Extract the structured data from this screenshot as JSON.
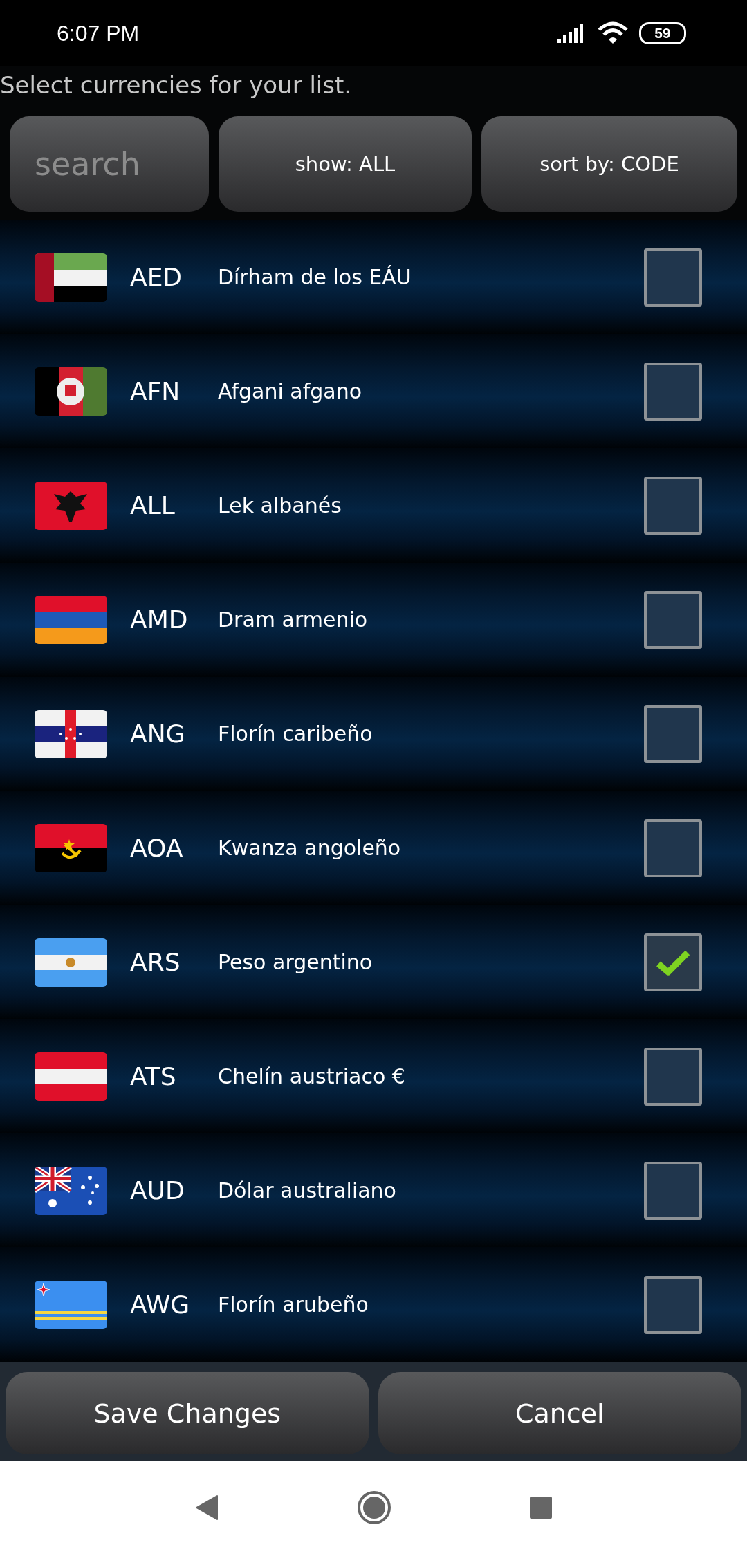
{
  "status_bar": {
    "time": "6:07 PM",
    "battery": "59"
  },
  "prompt": "Select currencies for your list.",
  "search": {
    "placeholder": "search"
  },
  "filter_button": "show: ALL",
  "sort_button": "sort by: CODE",
  "currencies": [
    {
      "code": "AED",
      "name": "Dírham de los EÁU",
      "checked": false
    },
    {
      "code": "AFN",
      "name": "Afgani afgano",
      "checked": false
    },
    {
      "code": "ALL",
      "name": "Lek albanés",
      "checked": false
    },
    {
      "code": "AMD",
      "name": "Dram armenio",
      "checked": false
    },
    {
      "code": "ANG",
      "name": "Florín caribeño",
      "checked": false
    },
    {
      "code": "AOA",
      "name": "Kwanza angoleño",
      "checked": false
    },
    {
      "code": "ARS",
      "name": "Peso argentino",
      "checked": true
    },
    {
      "code": "ATS",
      "name": "Chelín austriaco €",
      "checked": false
    },
    {
      "code": "AUD",
      "name": "Dólar australiano",
      "checked": false
    },
    {
      "code": "AWG",
      "name": "Florín arubeño",
      "checked": false
    }
  ],
  "buttons": [
    "Save Changes",
    "Cancel"
  ]
}
